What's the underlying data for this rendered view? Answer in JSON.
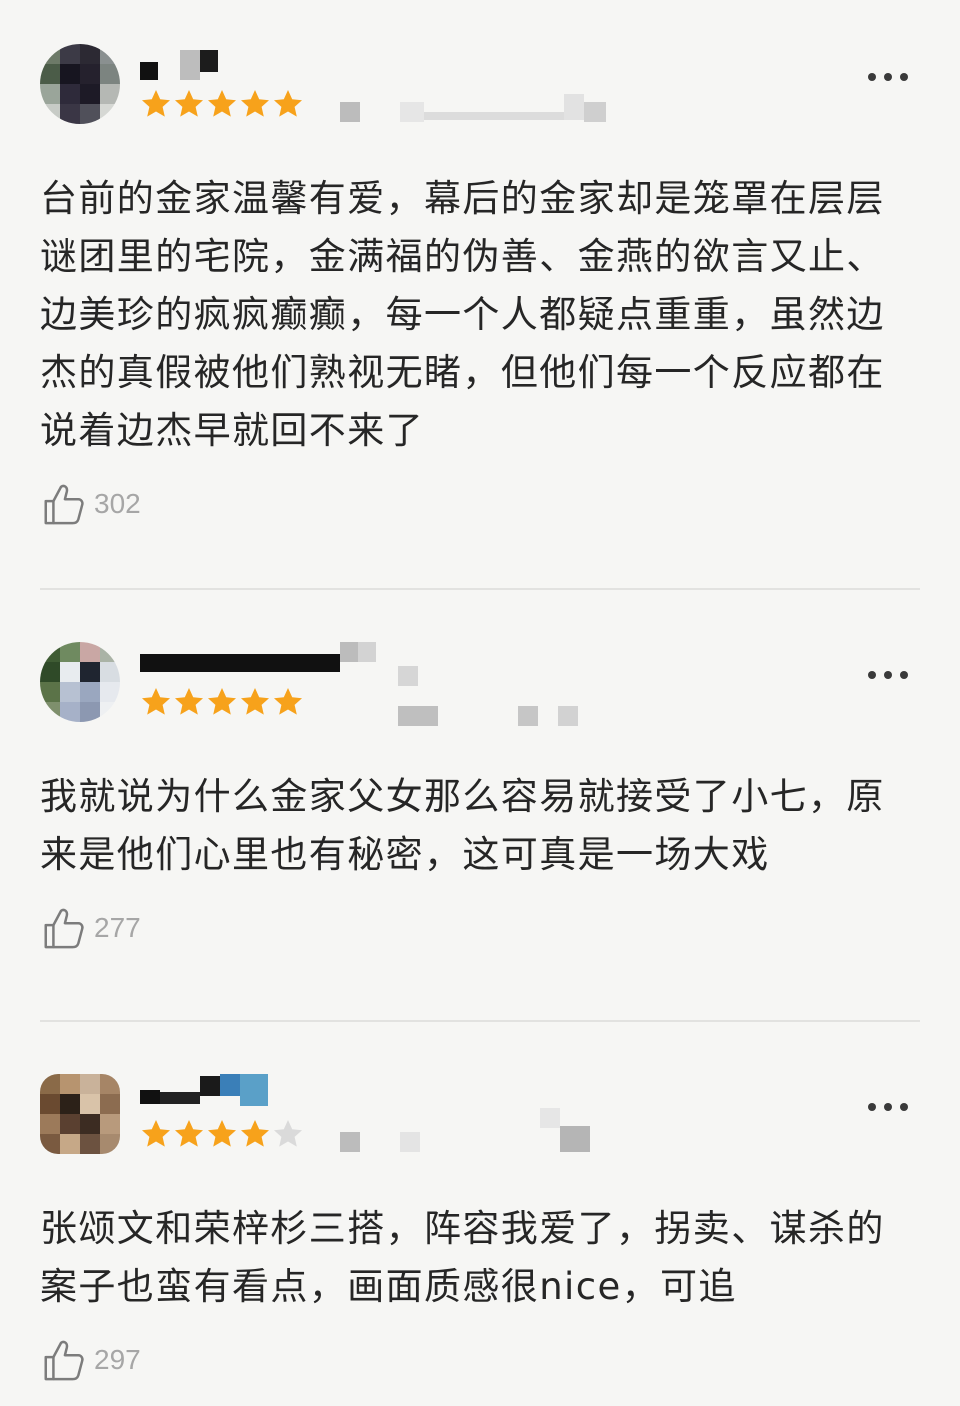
{
  "reviews": [
    {
      "rating": 5,
      "text": "台前的金家温馨有爱，幕后的金家却是笼罩在层层谜团里的宅院，金满福的伪善、金燕的欲言又止、边美珍的疯疯癫癫，每一个人都疑点重重，虽然边杰的真假被他们熟视无睹，但他们每一个反应都在说着边杰早就回不来了",
      "likes": "302"
    },
    {
      "rating": 5,
      "text": "我就说为什么金家父女那么容易就接受了小七，原来是他们心里也有秘密，这可真是一场大戏",
      "likes": "277"
    },
    {
      "rating": 4,
      "text": "张颂文和荣梓杉三搭，阵容我爱了，拐卖、谋杀的案子也蛮有看点，画面质感很nice，可追",
      "likes": "297"
    }
  ],
  "colors": {
    "star_filled": "#f7a21b",
    "star_empty": "#dadada",
    "like_count": "#a6a6a6",
    "divider": "#e2e2e0"
  },
  "icons": {
    "more": "more-dots-icon",
    "like": "thumbs-up-icon",
    "star": "star-icon"
  }
}
